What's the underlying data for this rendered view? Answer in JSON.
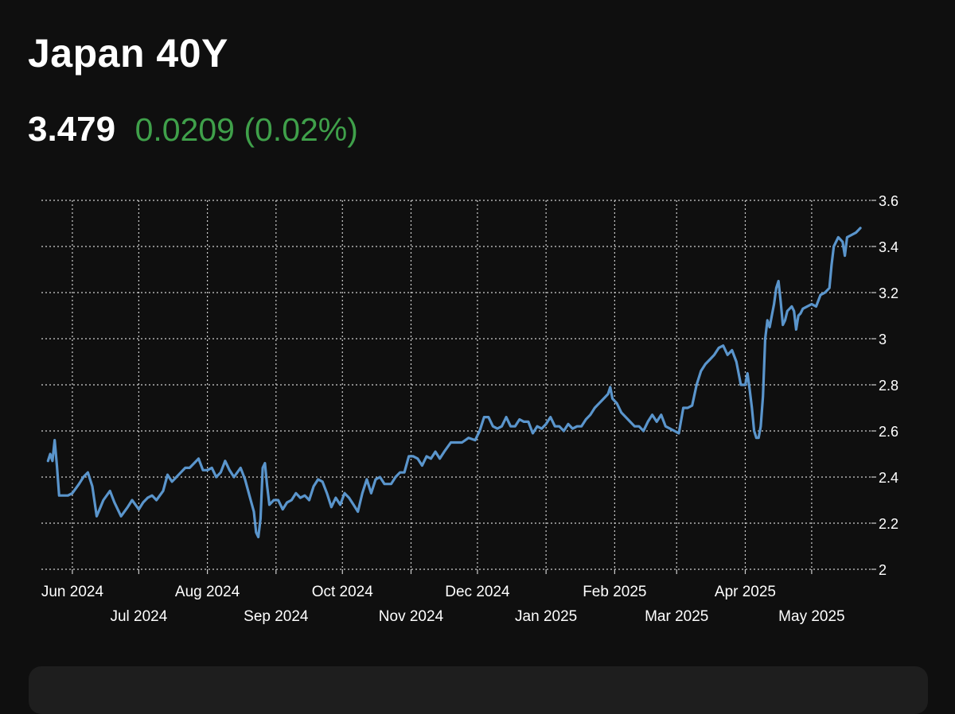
{
  "header": {
    "title": "Japan 40Y",
    "price": "3.479",
    "change": "0.0209 (0.02%)"
  },
  "colors": {
    "background": "#0f0f0f",
    "line": "#5a95cc",
    "positive": "#3fa04a",
    "grid": "#cfcfcf",
    "text": "#ffffff"
  },
  "chart_data": {
    "type": "line",
    "title": "",
    "xlabel": "",
    "ylabel": "",
    "ylim": [
      2.0,
      3.6
    ],
    "y_ticks": [
      "2",
      "2.2",
      "2.4",
      "2.6",
      "2.8",
      "3",
      "3.2",
      "3.4",
      "3.6"
    ],
    "x_ticks": [
      {
        "label": "Jun 2024",
        "date": "2024-06-01",
        "row": 1
      },
      {
        "label": "Jul 2024",
        "date": "2024-07-01",
        "row": 2
      },
      {
        "label": "Aug 2024",
        "date": "2024-08-01",
        "row": 1
      },
      {
        "label": "Sep 2024",
        "date": "2024-09-01",
        "row": 2
      },
      {
        "label": "Oct 2024",
        "date": "2024-10-01",
        "row": 1
      },
      {
        "label": "Nov 2024",
        "date": "2024-11-01",
        "row": 2
      },
      {
        "label": "Dec 2024",
        "date": "2024-12-01",
        "row": 1
      },
      {
        "label": "Jan 2025",
        "date": "2025-01-01",
        "row": 2
      },
      {
        "label": "Feb 2025",
        "date": "2025-02-01",
        "row": 1
      },
      {
        "label": "Mar 2025",
        "date": "2025-03-01",
        "row": 2
      },
      {
        "label": "Apr 2025",
        "date": "2025-04-01",
        "row": 1
      },
      {
        "label": "May 2025",
        "date": "2025-05-01",
        "row": 2
      }
    ],
    "grid": true,
    "y_axis_position": "right",
    "series": [
      {
        "points": [
          [
            "2024-05-21",
            2.47
          ],
          [
            "2024-05-22",
            2.5
          ],
          [
            "2024-05-23",
            2.47
          ],
          [
            "2024-05-24",
            2.56
          ],
          [
            "2024-05-25",
            2.45
          ],
          [
            "2024-05-26",
            2.32
          ],
          [
            "2024-05-28",
            2.32
          ],
          [
            "2024-05-30",
            2.32
          ],
          [
            "2024-06-01",
            2.33
          ],
          [
            "2024-06-04",
            2.37
          ],
          [
            "2024-06-06",
            2.4
          ],
          [
            "2024-06-08",
            2.42
          ],
          [
            "2024-06-10",
            2.36
          ],
          [
            "2024-06-12",
            2.23
          ],
          [
            "2024-06-15",
            2.3
          ],
          [
            "2024-06-18",
            2.34
          ],
          [
            "2024-06-20",
            2.29
          ],
          [
            "2024-06-23",
            2.23
          ],
          [
            "2024-06-26",
            2.27
          ],
          [
            "2024-06-28",
            2.3
          ],
          [
            "2024-07-01",
            2.26
          ],
          [
            "2024-07-03",
            2.29
          ],
          [
            "2024-07-05",
            2.31
          ],
          [
            "2024-07-07",
            2.32
          ],
          [
            "2024-07-09",
            2.3
          ],
          [
            "2024-07-12",
            2.34
          ],
          [
            "2024-07-14",
            2.41
          ],
          [
            "2024-07-16",
            2.38
          ],
          [
            "2024-07-18",
            2.4
          ],
          [
            "2024-07-20",
            2.42
          ],
          [
            "2024-07-22",
            2.44
          ],
          [
            "2024-07-24",
            2.44
          ],
          [
            "2024-07-26",
            2.46
          ],
          [
            "2024-07-28",
            2.48
          ],
          [
            "2024-07-30",
            2.43
          ],
          [
            "2024-08-01",
            2.43
          ],
          [
            "2024-08-03",
            2.44
          ],
          [
            "2024-08-05",
            2.4
          ],
          [
            "2024-08-07",
            2.42
          ],
          [
            "2024-08-09",
            2.47
          ],
          [
            "2024-08-11",
            2.43
          ],
          [
            "2024-08-13",
            2.4
          ],
          [
            "2024-08-16",
            2.44
          ],
          [
            "2024-08-18",
            2.39
          ],
          [
            "2024-08-20",
            2.32
          ],
          [
            "2024-08-22",
            2.25
          ],
          [
            "2024-08-23",
            2.16
          ],
          [
            "2024-08-24",
            2.14
          ],
          [
            "2024-08-25",
            2.22
          ],
          [
            "2024-08-26",
            2.44
          ],
          [
            "2024-08-27",
            2.46
          ],
          [
            "2024-08-28",
            2.36
          ],
          [
            "2024-08-29",
            2.28
          ],
          [
            "2024-08-31",
            2.3
          ],
          [
            "2024-09-02",
            2.3
          ],
          [
            "2024-09-04",
            2.26
          ],
          [
            "2024-09-06",
            2.29
          ],
          [
            "2024-09-08",
            2.3
          ],
          [
            "2024-09-10",
            2.33
          ],
          [
            "2024-09-12",
            2.31
          ],
          [
            "2024-09-14",
            2.32
          ],
          [
            "2024-09-16",
            2.3
          ],
          [
            "2024-09-18",
            2.36
          ],
          [
            "2024-09-20",
            2.39
          ],
          [
            "2024-09-22",
            2.38
          ],
          [
            "2024-09-24",
            2.33
          ],
          [
            "2024-09-26",
            2.27
          ],
          [
            "2024-09-28",
            2.31
          ],
          [
            "2024-09-30",
            2.28
          ],
          [
            "2024-10-02",
            2.33
          ],
          [
            "2024-10-04",
            2.31
          ],
          [
            "2024-10-06",
            2.28
          ],
          [
            "2024-10-08",
            2.25
          ],
          [
            "2024-10-10",
            2.33
          ],
          [
            "2024-10-12",
            2.39
          ],
          [
            "2024-10-14",
            2.33
          ],
          [
            "2024-10-16",
            2.39
          ],
          [
            "2024-10-18",
            2.4
          ],
          [
            "2024-10-20",
            2.37
          ],
          [
            "2024-10-23",
            2.37
          ],
          [
            "2024-10-25",
            2.4
          ],
          [
            "2024-10-27",
            2.42
          ],
          [
            "2024-10-29",
            2.42
          ],
          [
            "2024-10-31",
            2.49
          ],
          [
            "2024-11-02",
            2.49
          ],
          [
            "2024-11-04",
            2.48
          ],
          [
            "2024-11-06",
            2.45
          ],
          [
            "2024-11-08",
            2.49
          ],
          [
            "2024-11-10",
            2.48
          ],
          [
            "2024-11-12",
            2.51
          ],
          [
            "2024-11-14",
            2.48
          ],
          [
            "2024-11-16",
            2.51
          ],
          [
            "2024-11-19",
            2.55
          ],
          [
            "2024-11-21",
            2.55
          ],
          [
            "2024-11-24",
            2.55
          ],
          [
            "2024-11-27",
            2.57
          ],
          [
            "2024-11-30",
            2.56
          ],
          [
            "2024-12-02",
            2.6
          ],
          [
            "2024-12-04",
            2.66
          ],
          [
            "2024-12-06",
            2.66
          ],
          [
            "2024-12-08",
            2.62
          ],
          [
            "2024-12-10",
            2.61
          ],
          [
            "2024-12-12",
            2.62
          ],
          [
            "2024-12-14",
            2.66
          ],
          [
            "2024-12-16",
            2.62
          ],
          [
            "2024-12-18",
            2.62
          ],
          [
            "2024-12-20",
            2.65
          ],
          [
            "2024-12-22",
            2.64
          ],
          [
            "2024-12-24",
            2.64
          ],
          [
            "2024-12-26",
            2.59
          ],
          [
            "2024-12-28",
            2.62
          ],
          [
            "2024-12-30",
            2.61
          ],
          [
            "2025-01-01",
            2.63
          ],
          [
            "2025-01-03",
            2.66
          ],
          [
            "2025-01-05",
            2.62
          ],
          [
            "2025-01-07",
            2.62
          ],
          [
            "2025-01-09",
            2.6
          ],
          [
            "2025-01-11",
            2.63
          ],
          [
            "2025-01-13",
            2.61
          ],
          [
            "2025-01-15",
            2.62
          ],
          [
            "2025-01-17",
            2.62
          ],
          [
            "2025-01-19",
            2.65
          ],
          [
            "2025-01-21",
            2.67
          ],
          [
            "2025-01-23",
            2.7
          ],
          [
            "2025-01-25",
            2.72
          ],
          [
            "2025-01-27",
            2.74
          ],
          [
            "2025-01-29",
            2.76
          ],
          [
            "2025-01-30",
            2.79
          ],
          [
            "2025-01-31",
            2.74
          ],
          [
            "2025-02-02",
            2.72
          ],
          [
            "2025-02-04",
            2.68
          ],
          [
            "2025-02-06",
            2.66
          ],
          [
            "2025-02-08",
            2.64
          ],
          [
            "2025-02-10",
            2.62
          ],
          [
            "2025-02-12",
            2.62
          ],
          [
            "2025-02-14",
            2.6
          ],
          [
            "2025-02-16",
            2.64
          ],
          [
            "2025-02-18",
            2.67
          ],
          [
            "2025-02-20",
            2.64
          ],
          [
            "2025-02-22",
            2.67
          ],
          [
            "2025-02-24",
            2.62
          ],
          [
            "2025-02-26",
            2.61
          ],
          [
            "2025-02-28",
            2.6
          ],
          [
            "2025-03-02",
            2.59
          ],
          [
            "2025-03-04",
            2.7
          ],
          [
            "2025-03-06",
            2.7
          ],
          [
            "2025-03-08",
            2.71
          ],
          [
            "2025-03-10",
            2.8
          ],
          [
            "2025-03-12",
            2.86
          ],
          [
            "2025-03-14",
            2.89
          ],
          [
            "2025-03-16",
            2.91
          ],
          [
            "2025-03-18",
            2.93
          ],
          [
            "2025-03-20",
            2.96
          ],
          [
            "2025-03-22",
            2.97
          ],
          [
            "2025-03-24",
            2.93
          ],
          [
            "2025-03-26",
            2.95
          ],
          [
            "2025-03-28",
            2.9
          ],
          [
            "2025-03-30",
            2.8
          ],
          [
            "2025-04-01",
            2.8
          ],
          [
            "2025-04-02",
            2.85
          ],
          [
            "2025-04-03",
            2.78
          ],
          [
            "2025-04-04",
            2.7
          ],
          [
            "2025-04-05",
            2.6
          ],
          [
            "2025-04-06",
            2.57
          ],
          [
            "2025-04-07",
            2.57
          ],
          [
            "2025-04-08",
            2.62
          ],
          [
            "2025-04-09",
            2.75
          ],
          [
            "2025-04-10",
            3.0
          ],
          [
            "2025-04-11",
            3.08
          ],
          [
            "2025-04-12",
            3.05
          ],
          [
            "2025-04-13",
            3.1
          ],
          [
            "2025-04-14",
            3.15
          ],
          [
            "2025-04-15",
            3.22
          ],
          [
            "2025-04-16",
            3.25
          ],
          [
            "2025-04-17",
            3.16
          ],
          [
            "2025-04-18",
            3.06
          ],
          [
            "2025-04-19",
            3.08
          ],
          [
            "2025-04-20",
            3.12
          ],
          [
            "2025-04-21",
            3.13
          ],
          [
            "2025-04-22",
            3.14
          ],
          [
            "2025-04-23",
            3.12
          ],
          [
            "2025-04-24",
            3.04
          ],
          [
            "2025-04-25",
            3.1
          ],
          [
            "2025-04-26",
            3.11
          ],
          [
            "2025-04-27",
            3.13
          ],
          [
            "2025-04-29",
            3.14
          ],
          [
            "2025-05-01",
            3.15
          ],
          [
            "2025-05-03",
            3.14
          ],
          [
            "2025-05-05",
            3.19
          ],
          [
            "2025-05-07",
            3.2
          ],
          [
            "2025-05-09",
            3.22
          ],
          [
            "2025-05-10",
            3.32
          ],
          [
            "2025-05-11",
            3.4
          ],
          [
            "2025-05-13",
            3.44
          ],
          [
            "2025-05-15",
            3.42
          ],
          [
            "2025-05-16",
            3.36
          ],
          [
            "2025-05-17",
            3.44
          ],
          [
            "2025-05-19",
            3.45
          ],
          [
            "2025-05-21",
            3.46
          ],
          [
            "2025-05-23",
            3.48
          ]
        ]
      }
    ]
  }
}
